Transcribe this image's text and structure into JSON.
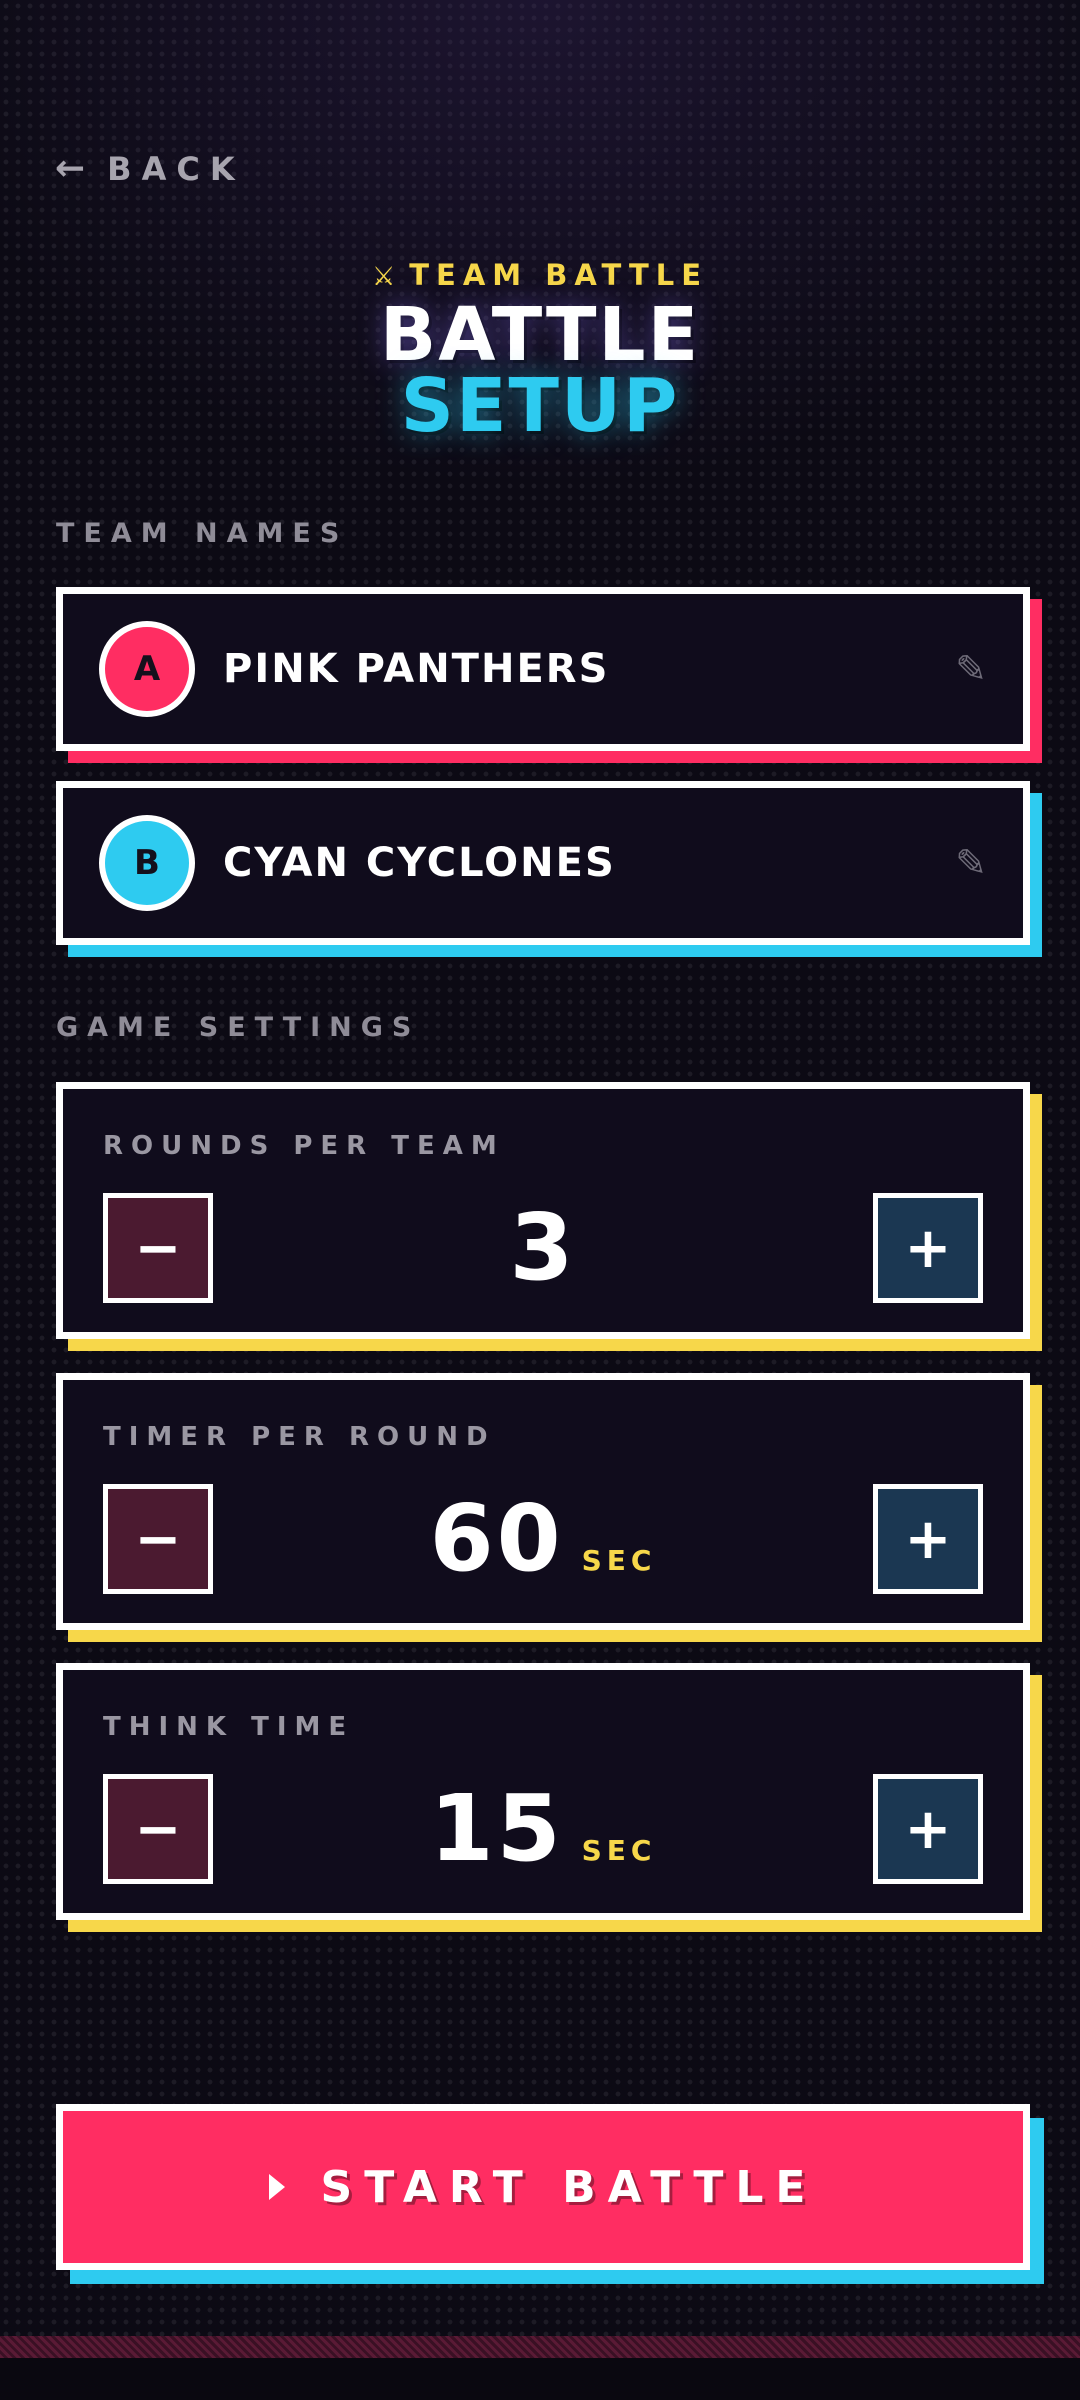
{
  "nav": {
    "back_arrow": "←",
    "back_label": "BACK"
  },
  "header": {
    "mode_icon": "⚔",
    "mode_label": "TEAM BATTLE",
    "title_line1": "BATTLE",
    "title_line2": "SETUP"
  },
  "sections": {
    "team_names": "TEAM NAMES",
    "game_settings": "GAME SETTINGS"
  },
  "teams": [
    {
      "badge": "A",
      "name": "PINK PANTHERS",
      "color": "#ff2d62",
      "edit_icon": "✎"
    },
    {
      "badge": "B",
      "name": "CYAN CYCLONES",
      "color": "#2ecbf0",
      "edit_icon": "✎"
    }
  ],
  "settings": [
    {
      "label": "ROUNDS PER TEAM",
      "value": "3",
      "unit": ""
    },
    {
      "label": "TIMER PER ROUND",
      "value": "60",
      "unit": "SEC"
    },
    {
      "label": "THINK TIME",
      "value": "15",
      "unit": "SEC"
    }
  ],
  "stepper": {
    "minus_symbol": "−",
    "plus_symbol": "+"
  },
  "start_button": {
    "label": "START BATTLE"
  },
  "colors": {
    "accent_pink": "#ff2d62",
    "accent_cyan": "#2ecbf0",
    "accent_yellow": "#f7d74a",
    "background": "#0c0a14"
  }
}
